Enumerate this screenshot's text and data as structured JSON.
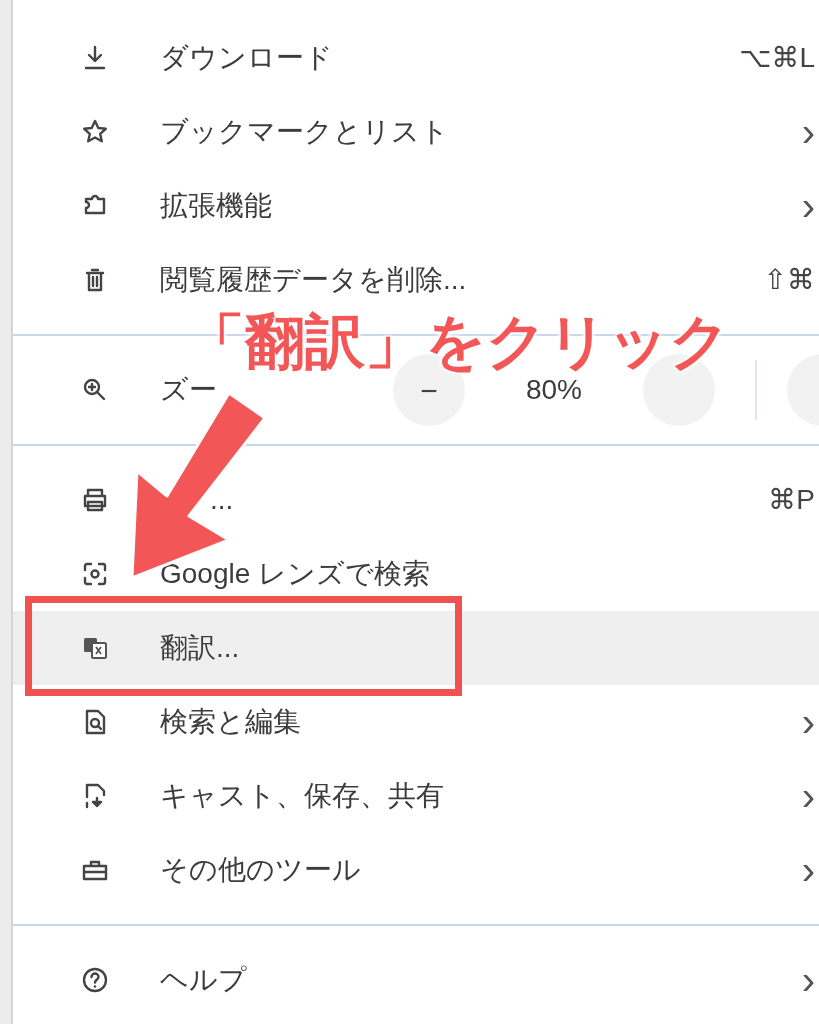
{
  "menu": {
    "rows": [
      {
        "kind": "item",
        "label": "ダウンロード",
        "shortcut": "⌥⌘L",
        "highlighted": false
      },
      {
        "kind": "item",
        "label": "ブックマークとリスト",
        "submenu": "›",
        "highlighted": false
      },
      {
        "kind": "item",
        "label": "拡張機能",
        "submenu": "›",
        "highlighted": false
      },
      {
        "kind": "item",
        "label": "閲覧履歴データを削除...",
        "shortcut": "⇧⌘",
        "highlighted": false
      },
      {
        "kind": "separator"
      },
      {
        "kind": "zoom",
        "label": "ズー",
        "minus": "−",
        "reading": "80%"
      },
      {
        "kind": "separator"
      },
      {
        "kind": "item",
        "label": "...",
        "shortcut": "⌘P",
        "highlighted": false
      },
      {
        "kind": "item",
        "label": "Google レンズで検索",
        "highlighted": false
      },
      {
        "kind": "item",
        "label": "翻訳...",
        "highlighted": true
      },
      {
        "kind": "item",
        "label": "検索と編集",
        "submenu": "›",
        "highlighted": false
      },
      {
        "kind": "item",
        "label": "キャスト、保存、共有",
        "submenu": "›",
        "highlighted": false
      },
      {
        "kind": "item",
        "label": "その他のツール",
        "submenu": "›",
        "highlighted": false
      },
      {
        "kind": "separator"
      },
      {
        "kind": "item",
        "label": "ヘルプ",
        "submenu": "›",
        "highlighted": false
      }
    ]
  },
  "annotation": {
    "title": "「翻訳」をクリック"
  }
}
